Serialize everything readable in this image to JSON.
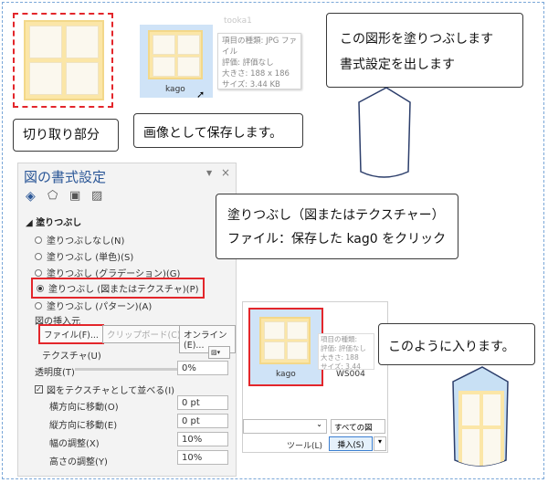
{
  "callouts": {
    "crop": "切り取り部分",
    "save": "画像として保存します。",
    "fill_line1": "この図形を塗りつぶします",
    "fill_line2": "書式設定を出します",
    "texture_line1": "塗りつぶし（図またはテクスチャー）",
    "texture_line2": "ファイル：保存した kag0 をクリック",
    "result": "このように入ります。"
  },
  "thumbnail": {
    "caption": "kago",
    "tooltip": [
      "項目の種類: JPG ファイル",
      "評価: 評価なし",
      "大きさ: 188 x 186",
      "サイズ: 3.44 KB"
    ],
    "ghost_label": "tooka1"
  },
  "panel": {
    "title": "図の書式設定",
    "section": "塗りつぶし",
    "options": [
      "塗りつぶしなし(N)",
      "塗りつぶし (単色)(S)",
      "塗りつぶし (グラデーション)(G)",
      "塗りつぶし (図またはテクスチャ)(P)",
      "塗りつぶし (パターン)(A)"
    ],
    "insert_source": "図の挿入元",
    "file_button": "ファイル(F)...",
    "clipboard_button": "クリップボード(C)",
    "online_button": "オンライン(E)...",
    "texture_label": "テクスチャ(U)",
    "transparency_label": "透明度(T)",
    "transparency_value": "0%",
    "tile_checkbox": "図をテクスチャとして並べる(I)",
    "offset_x_label": "横方向に移動(O)",
    "offset_x_value": "0 pt",
    "offset_y_label": "縦方向に移動(E)",
    "offset_y_value": "0 pt",
    "scale_x_label": "幅の調整(X)",
    "scale_x_value": "10%",
    "scale_y_label": "高さの調整(Y)",
    "scale_y_value": "10%"
  },
  "file_dialog": {
    "selected_caption": "kago",
    "other_caption": "WS004",
    "filter": "すべての図",
    "tools": "ツール(L)",
    "insert": "挿入(S)",
    "tooltip": [
      "項目の種類:",
      "評価: 評価なし",
      "大きさ: 188",
      "サイズ: 3.44"
    ]
  },
  "colors": {
    "accent_red": "#e3262b",
    "pane_gold": "#fbe6a7",
    "panel_blue": "#2b5797",
    "shape_fill": "#c8e0f4"
  }
}
